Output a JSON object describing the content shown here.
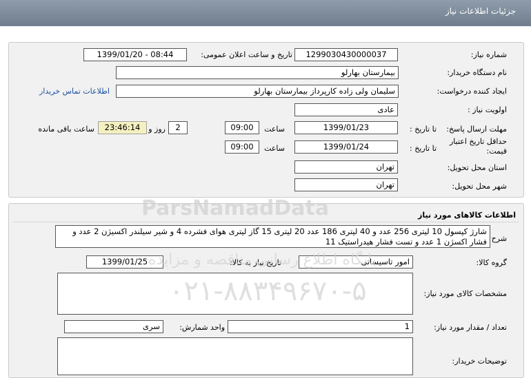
{
  "header": {
    "title": "جزئیات اطلاعات نیاز"
  },
  "watermark": {
    "brand": "ParsNamadData",
    "text": "پایگاه اطلاع رسانی مناقصه و مزایده",
    "phone": "۰۲۱-۸۸۳۴۹۶۷۰-۵"
  },
  "info": {
    "need_number_label": "شماره نیاز:",
    "need_number": "1299030430000037",
    "announce_label": "تاریخ و ساعت اعلان عمومی:",
    "announce_value": "1399/01/20 - 08:44",
    "buyer_org_label": "نام دستگاه خریدار:",
    "buyer_org": "بیمارستان بهارلو",
    "creator_label": "ایجاد کننده درخواست:",
    "creator": "سلیمان  ولی زاده  کارپرداز بیمارستان بهارلو",
    "contact_link": "اطلاعات تماس خریدار",
    "priority_label": "اولویت نیاز :",
    "priority": "عادی",
    "deadline_label": "مهلت ارسال پاسخ:",
    "to_date_label": "تا تاریخ :",
    "deadline_date": "1399/01/23",
    "time_label": "ساعت",
    "deadline_time": "09:00",
    "days_count": "2",
    "days_and": "روز و",
    "remaining_time": "23:46:14",
    "remaining_label": "ساعت باقی مانده",
    "validity_label": "حداقل تاریخ اعتبار قیمت:",
    "validity_date": "1399/01/24",
    "validity_time": "09:00",
    "province_label": "استان محل تحویل:",
    "province": "تهران",
    "city_label": "شهر محل تحویل:",
    "city": "تهران"
  },
  "goods": {
    "section_title": "اطلاعات کالاهای مورد نیاز",
    "summary_label": "شرح کلی نیاز:",
    "summary": "شارژ کپسول 10 لیتری 256 عدد و 40 لیتری 186 عدد 20 لیتری 15 گاز لیتری هوای فشرده 4 و شیر سیلندر اکسیژن 2 عدد و فشار اکسژن 1 عدد و تست فشار هیدراستیک 11",
    "group_label": "گروه کالا:",
    "group": "امور تاسیساتی",
    "need_date_label": "تاریخ نیاز به کالا:",
    "need_date": "1399/01/25",
    "specs_label": "مشخصات کالای مورد نیاز:",
    "specs": "",
    "qty_label": "تعداد / مقدار مورد نیاز:",
    "qty": "1",
    "unit_label": "واحد شمارش:",
    "unit": "سری",
    "notes_label": "توضیحات خریدار:",
    "notes": ""
  }
}
